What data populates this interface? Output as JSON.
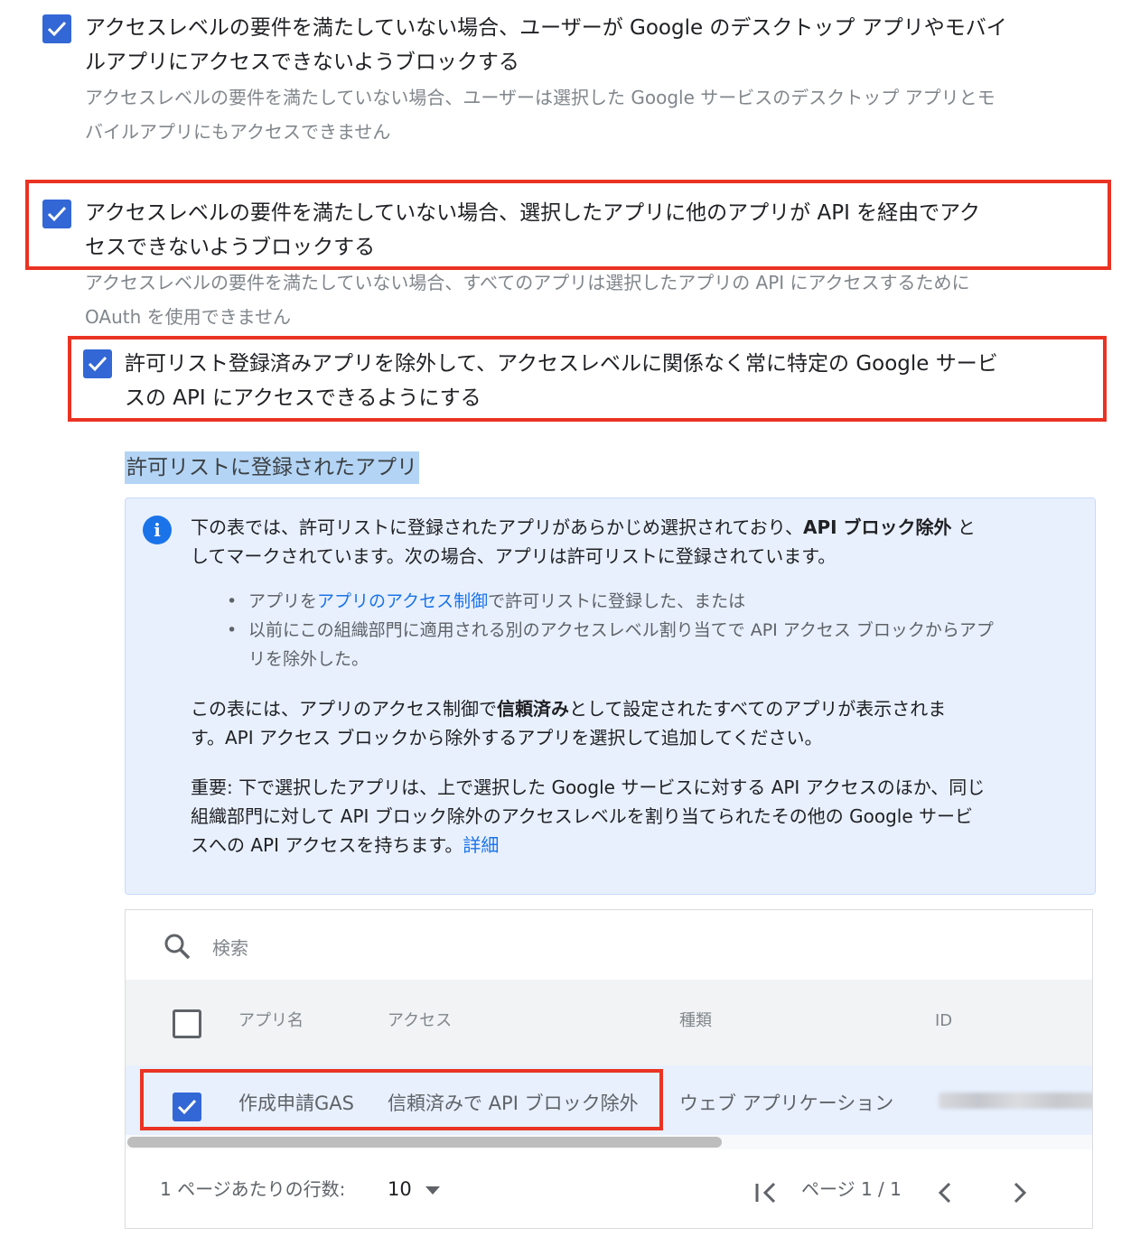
{
  "options": [
    {
      "label": "アクセスレベルの要件を満たしていない場合、ユーザーが Google のデスクトップ アプリやモバイルアプリにアクセスできないようブロックする",
      "label_line1": "アクセスレベルの要件を満たしていない場合、ユーザーが Google のデスクトップ アプリやモバイ",
      "label_line2": "ルアプリにアクセスできないようブロックする",
      "desc_line1": "アクセスレベルの要件を満たしていない場合、ユーザーは選択した Google サービスのデスクトップ アプリとモ",
      "desc_line2": "バイルアプリにもアクセスできません",
      "checked": true
    },
    {
      "label_line1": "アクセスレベルの要件を満たしていない場合、選択したアプリに他のアプリが API を経由でアク",
      "label_line2": "セスできないようブロックする",
      "desc_line1": "アクセスレベルの要件を満たしていない場合、すべてのアプリは選択したアプリの API にアクセスするために",
      "desc_line2": "OAuth を使用できません",
      "checked": true
    },
    {
      "label_line1": "許可リスト登録済みアプリを除外して、アクセスレベルに関係なく常に特定の Google サービ",
      "label_line2": "スの API にアクセスできるようにする",
      "checked": true
    }
  ],
  "section_title": "許可リストに登録されたアプリ",
  "info": {
    "icon": "info-icon",
    "p1_a": "下の表では、許可リストに登録されたアプリがあらかじめ選択されており、",
    "p1_bold": "API ブロック除外",
    "p1_b": " と",
    "p1_line2": "してマークされています。次の場合、アプリは許可リストに登録されています。",
    "bullet1_a": "アプリを",
    "bullet1_link": "アプリのアクセス制御",
    "bullet1_b": "で許可リストに登録した、または",
    "bullet2_line1": "以前にこの組織部門に適用される別のアクセスレベル割り当てで API アクセス ブロックからアプ",
    "bullet2_line2": "リを除外した。",
    "p2_a": "この表には、アプリのアクセス制御で",
    "p2_bold": "信頼済み",
    "p2_b": "として設定されたすべてのアプリが表示されま",
    "p2_line2": "す。API アクセス ブロックから除外するアプリを選択して追加してください。",
    "p3_line1": "重要: 下で選択したアプリは、上で選択した Google サービスに対する API アクセスのほか、同じ",
    "p3_line2": "組織部門に対して API ブロック除外のアクセスレベルを割り当てられたその他の Google サービ",
    "p3_line3": "スへの API アクセスを持ちます。",
    "p3_link": "詳細"
  },
  "table": {
    "search_placeholder": "検索",
    "columns": [
      "アプリ名",
      "アクセス",
      "種類",
      "ID"
    ],
    "rows": [
      {
        "checked": true,
        "name": "作成申請GAS",
        "access": "信頼済みで API ブロック除外",
        "type": "ウェブ アプリケーション"
      }
    ],
    "rows_per_page_label": "1 ページあたりの行数:",
    "rows_per_page": "10",
    "page_label": "ページ 1 / 1"
  },
  "colors": {
    "accent": "#3367d6",
    "highlight": "#ea3323",
    "info_bg": "#e8f0fe"
  }
}
